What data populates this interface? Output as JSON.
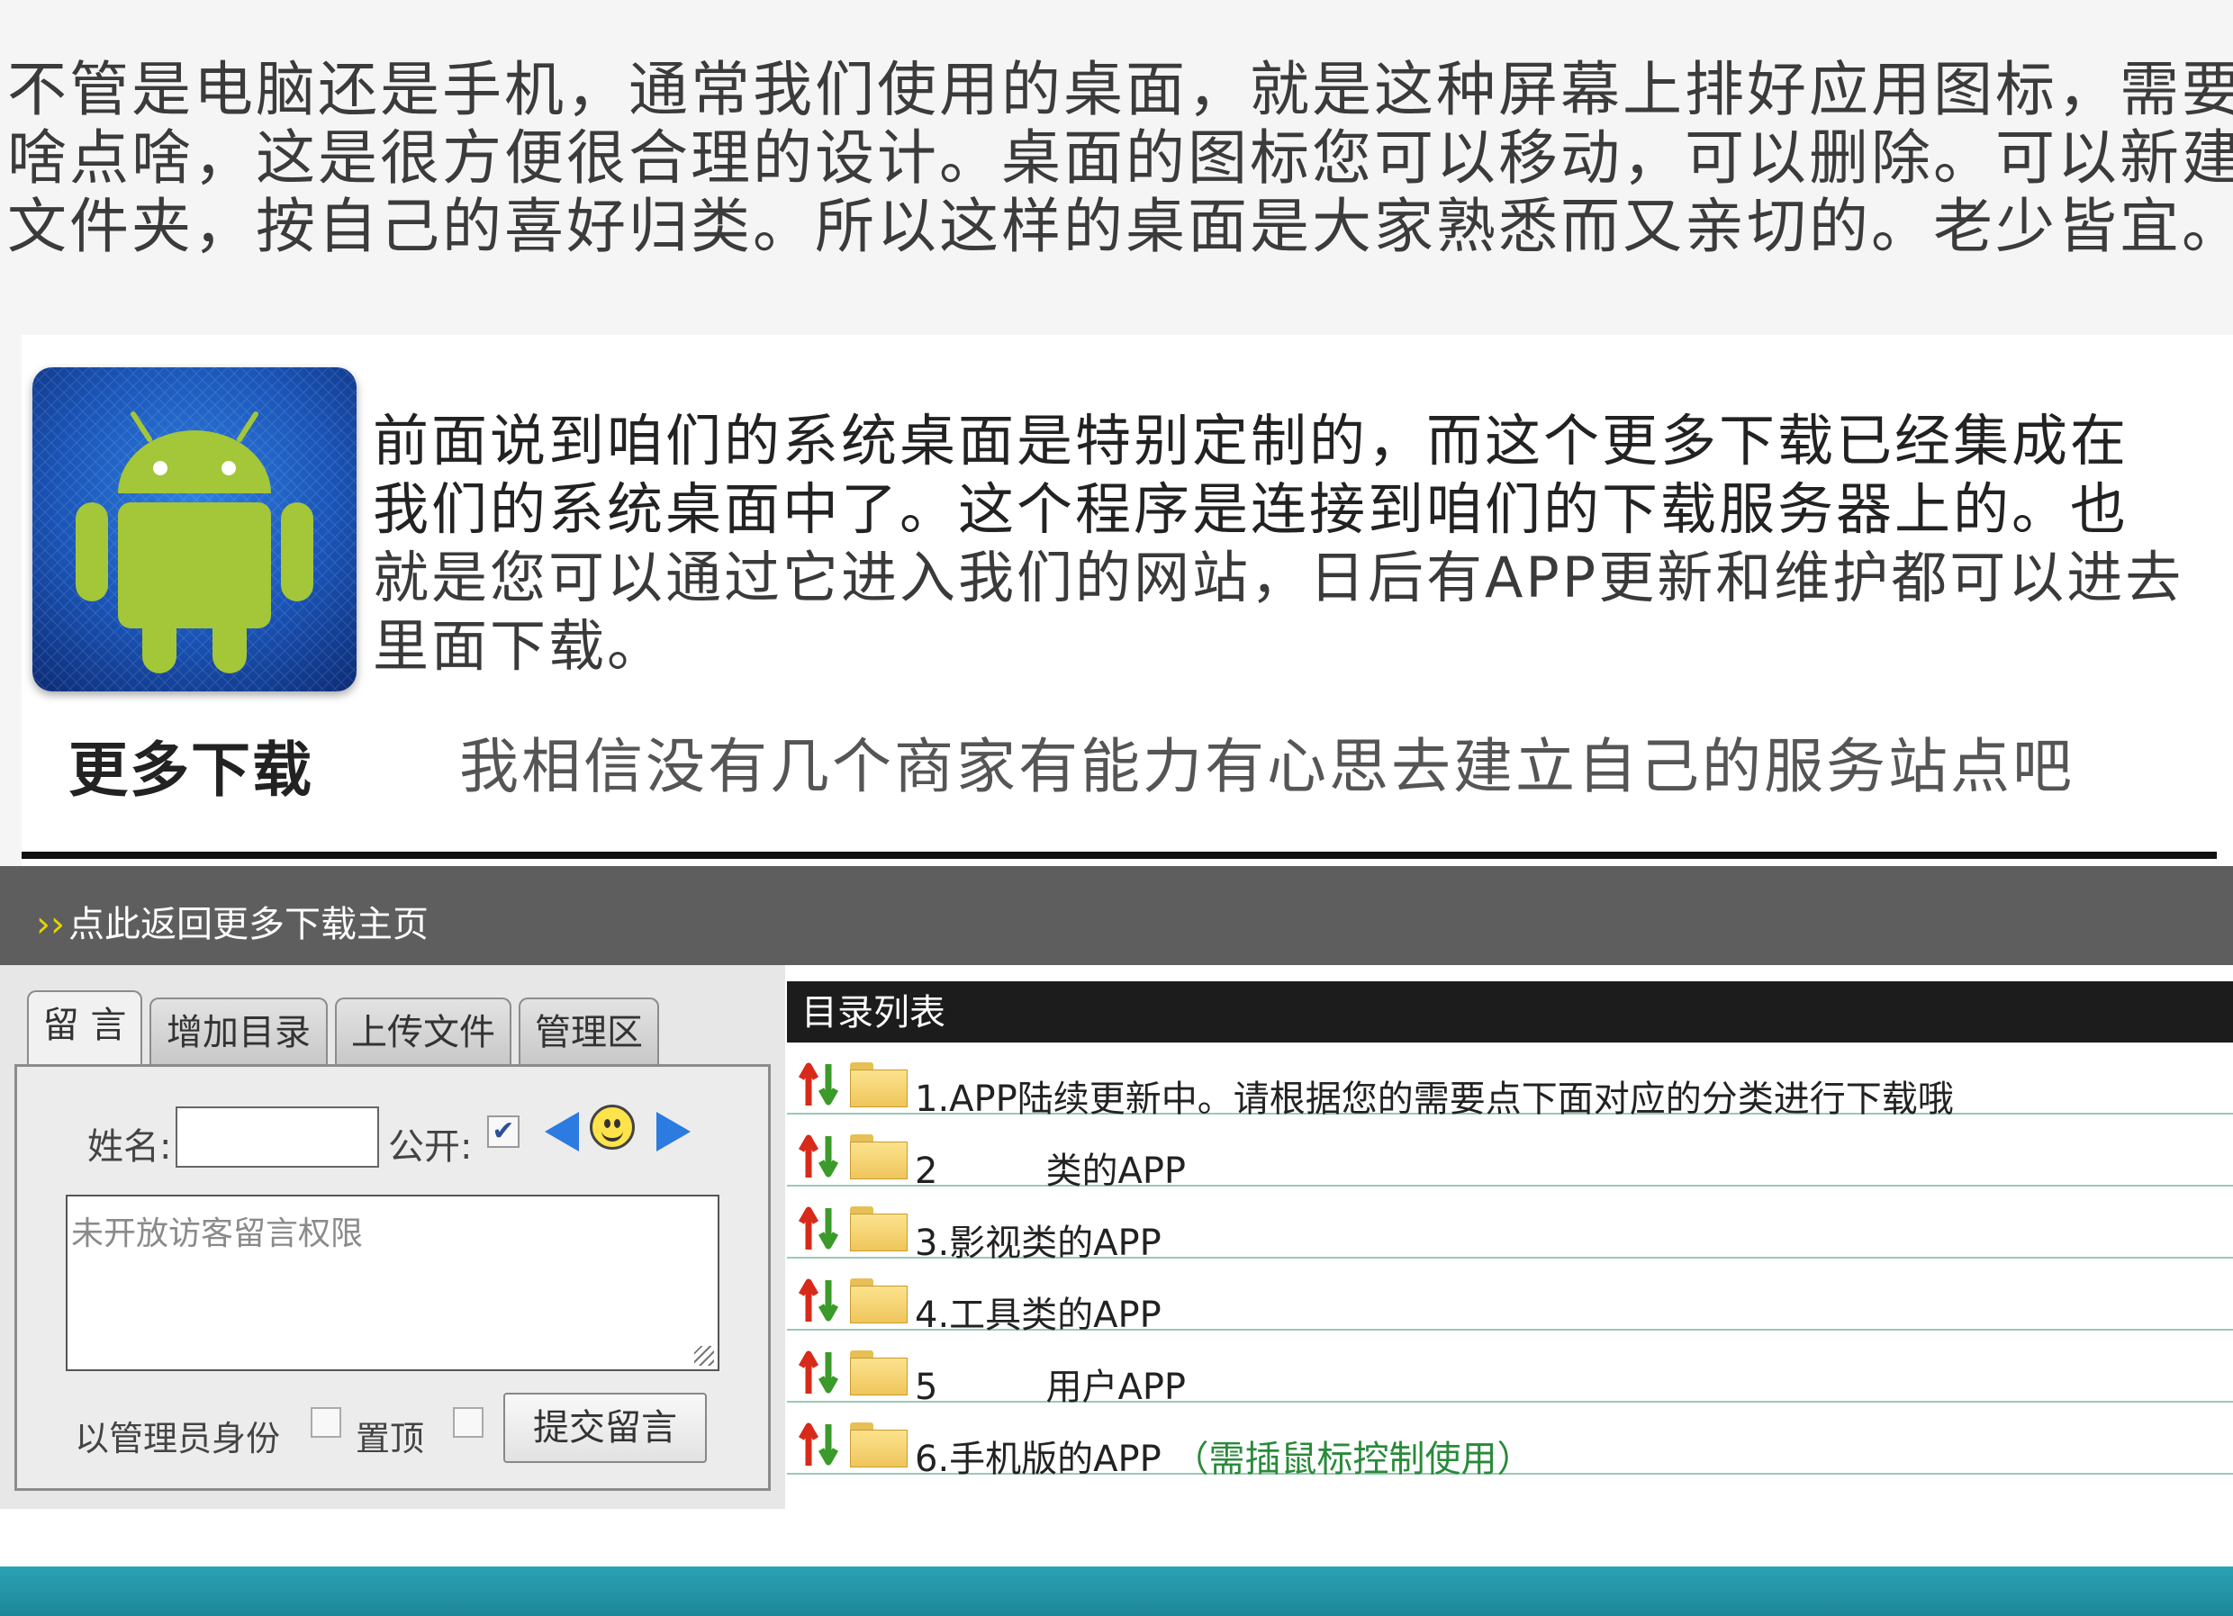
{
  "intro": {
    "lines": [
      "不管是电脑还是手机，通常我们使用的桌面，就是这种屏幕上排好应用图标，需要",
      "啥点啥，这是很方便很合理的设计。桌面的图标您可以移动，可以删除。可以新建",
      "文件夹，按自己的喜好归类。所以这样的桌面是大家熟悉而又亲切的。老少皆宜。"
    ]
  },
  "promo": {
    "lines": [
      "前面说到咱们的系统桌面是特别定制的，而这个更多下载已经集成在",
      "我们的系统桌面中了。这个程序是连接到咱们的下载服务器上的。也",
      "就是您可以通过它进入我们的网站，日后有APP更新和维护都可以进去",
      "里面下载。"
    ],
    "caption": "更多下载",
    "tagline": "我相信没有几个商家有能力有心思去建立自己的服务站点吧"
  },
  "site_bar": {
    "chevron": "››",
    "link_text": "点此返回更多下载主页"
  },
  "guestbook": {
    "tabs": [
      "留 言",
      "增加目录",
      "上传文件",
      "管理区"
    ],
    "name_label": "姓名:",
    "name_value": "",
    "public_label": "公开:",
    "public_checked": true,
    "message_placeholder": "未开放访客留言权限",
    "admin_label": "以管理员身份",
    "pin_label": "置顶",
    "submit_label": "提交留言"
  },
  "directory": {
    "header": "目录列表",
    "rows": [
      {
        "label": "1.APP陆续更新中。请根据您的需要点下面对应的分类进行下载哦"
      },
      {
        "prefix": "2",
        "label": "类的APP"
      },
      {
        "label": "3.影视类的APP"
      },
      {
        "label": "4.工具类的APP"
      },
      {
        "prefix": "5",
        "label": "用户APP"
      },
      {
        "label": "6.手机版的APP",
        "note": "（需插鼠标控制使用）"
      }
    ]
  },
  "colors": {
    "site_bar": "#5e5e5e",
    "directory_header": "#1c1c1c",
    "row_divider": "#9bc9b6",
    "note_green": "#2a8a3a",
    "bottom_band": "#2aa3b5"
  },
  "icons": [
    "android-logo-icon",
    "arrow-left-icon",
    "smiley-icon",
    "arrow-right-icon",
    "sort-icon",
    "folder-icon"
  ]
}
